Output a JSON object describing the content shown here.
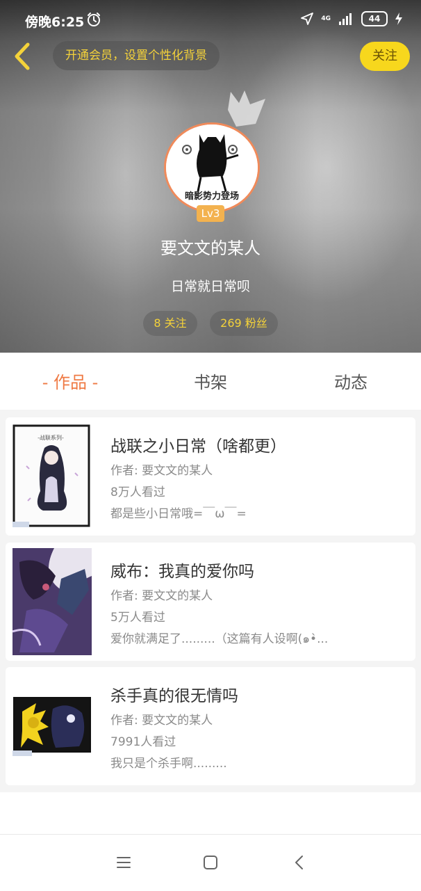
{
  "status_bar": {
    "time": "傍晚6:25",
    "network": "4G",
    "battery": "44",
    "icons": [
      "alarm-icon",
      "location-arrow-icon",
      "signal-icon",
      "battery-icon",
      "charging-icon"
    ]
  },
  "header": {
    "member_pill": "开通会员，设置个性化背景",
    "follow_label": "关注",
    "avatar_caption": "暗影势力登场",
    "level": "Lv3",
    "username": "要文文的某人",
    "signature": "日常就日常呗",
    "following": "8 关注",
    "followers": "269 粉丝"
  },
  "tabs": [
    {
      "label": "- 作品 -",
      "active": true
    },
    {
      "label": "书架",
      "active": false
    },
    {
      "label": "动态",
      "active": false
    }
  ],
  "works": [
    {
      "title": "战联之小日常（啥都更）",
      "author": "作者: 要文文的某人",
      "views": "8万人看过",
      "desc": "都是些小日常哦=￣ω￣="
    },
    {
      "title": "威布：我真的爱你吗",
      "author": "作者: 要文文的某人",
      "views": "5万人看过",
      "desc": "爱你就满足了.........（这篇有人设啊(๑•̀..."
    },
    {
      "title": "杀手真的很无情吗",
      "author": "作者: 要文文的某人",
      "views": "7991人看过",
      "desc": "我只是个杀手啊........."
    }
  ],
  "colors": {
    "accent": "#ef7a44",
    "follow_button": "#f7d71d",
    "highlight_text": "#f4d23a",
    "avatar_ring": "#f08a5a",
    "level_badge": "#f3b24f"
  }
}
